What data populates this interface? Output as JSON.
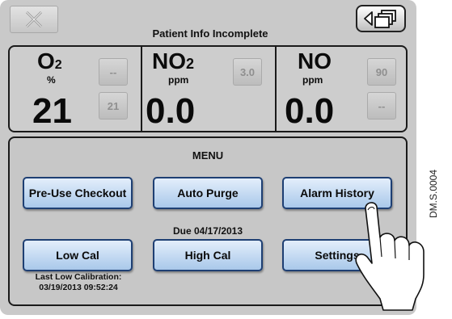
{
  "header": {
    "status_title": "Patient Info Incomplete"
  },
  "gases": [
    {
      "label_main": "O",
      "label_sub": "2",
      "unit": "%",
      "value": "21",
      "alarm_high": "--",
      "alarm_low": "21"
    },
    {
      "label_main": "NO",
      "label_sub": "2",
      "unit": "ppm",
      "value": "0.0",
      "alarm_high": "3.0",
      "alarm_low": ""
    },
    {
      "label_main": "NO",
      "label_sub": "",
      "unit": "ppm",
      "value": "0.0",
      "alarm_high": "90",
      "alarm_low": "--"
    }
  ],
  "menu": {
    "title": "MENU",
    "buttons": {
      "pre_use_checkout": "Pre-Use Checkout",
      "auto_purge": "Auto Purge",
      "alarm_history": "Alarm History",
      "low_cal": "Low Cal",
      "high_cal": "High Cal",
      "settings": "Settings"
    },
    "high_cal_due": "Due 04/17/2013",
    "last_low_cal_label": "Last Low Calibration:",
    "last_low_cal_time": "03/19/2013 09:52:24"
  },
  "figure_code": "DM.S.0004",
  "icons": {
    "close": "close-x-icon",
    "screens": "overlapping-windows-icon",
    "hand": "pointing-hand-icon"
  },
  "colors": {
    "screen_bg": "#c9c9c9",
    "menu_button_fill": "#a9c8ea",
    "menu_button_border": "#1e3f73",
    "alarm_text": "#8f8f8f"
  }
}
